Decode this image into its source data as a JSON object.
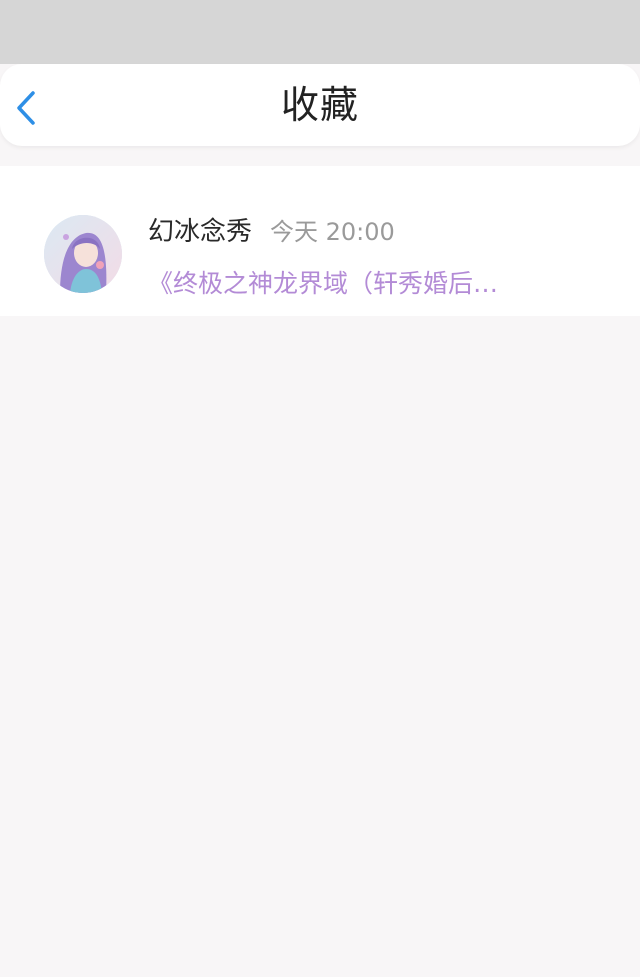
{
  "header": {
    "title": "收藏",
    "back_icon": "chevron-left-icon",
    "accent_color": "#2e8fe6"
  },
  "favorites": [
    {
      "user_name": "幻冰念秀",
      "timestamp": "今天 20:00",
      "preview": "《终极之神龙界域（轩秀婚后…",
      "preview_color": "#b38bd6"
    }
  ]
}
